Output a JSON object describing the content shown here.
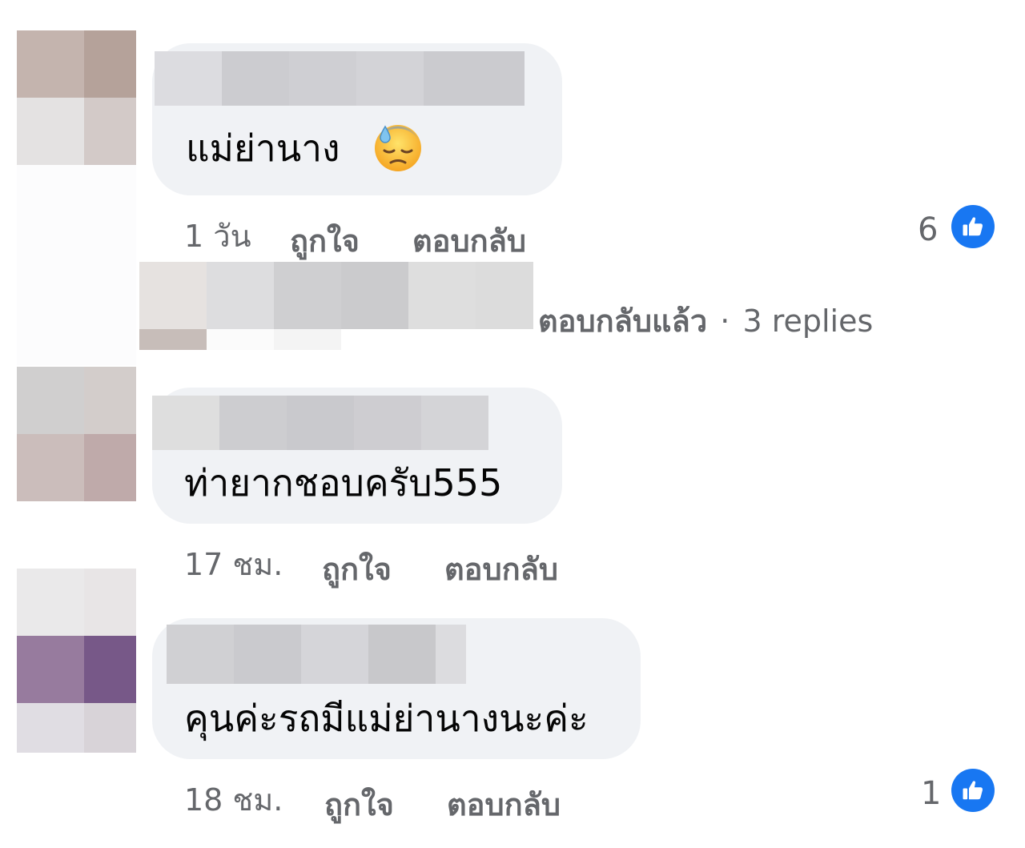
{
  "comments": [
    {
      "text": "แม่ย่านาง",
      "time": "1 วัน",
      "like_label": "ถูกใจ",
      "reply_label": "ตอบกลับ",
      "reactions": "6",
      "emoji": "downcast-face-with-sweat"
    },
    {
      "text": "ท่ายากชอบครับ555",
      "time": "17 ชม.",
      "like_label": "ถูกใจ",
      "reply_label": "ตอบกลับ"
    },
    {
      "text": "คุนค่ะรถมีแม่ย่านางนะค่ะ",
      "time": "18 ชม.",
      "like_label": "ถูกใจ",
      "reply_label": "ตอบกลับ",
      "reactions": "1"
    }
  ],
  "reply_summary": {
    "replied_label": "ตอบกลับแล้ว",
    "separator": "·",
    "count_label": "3 replies"
  },
  "colors": {
    "bubble": "#f0f2f5",
    "like_blue": "#1877f2",
    "meta_gray": "#65676b"
  }
}
